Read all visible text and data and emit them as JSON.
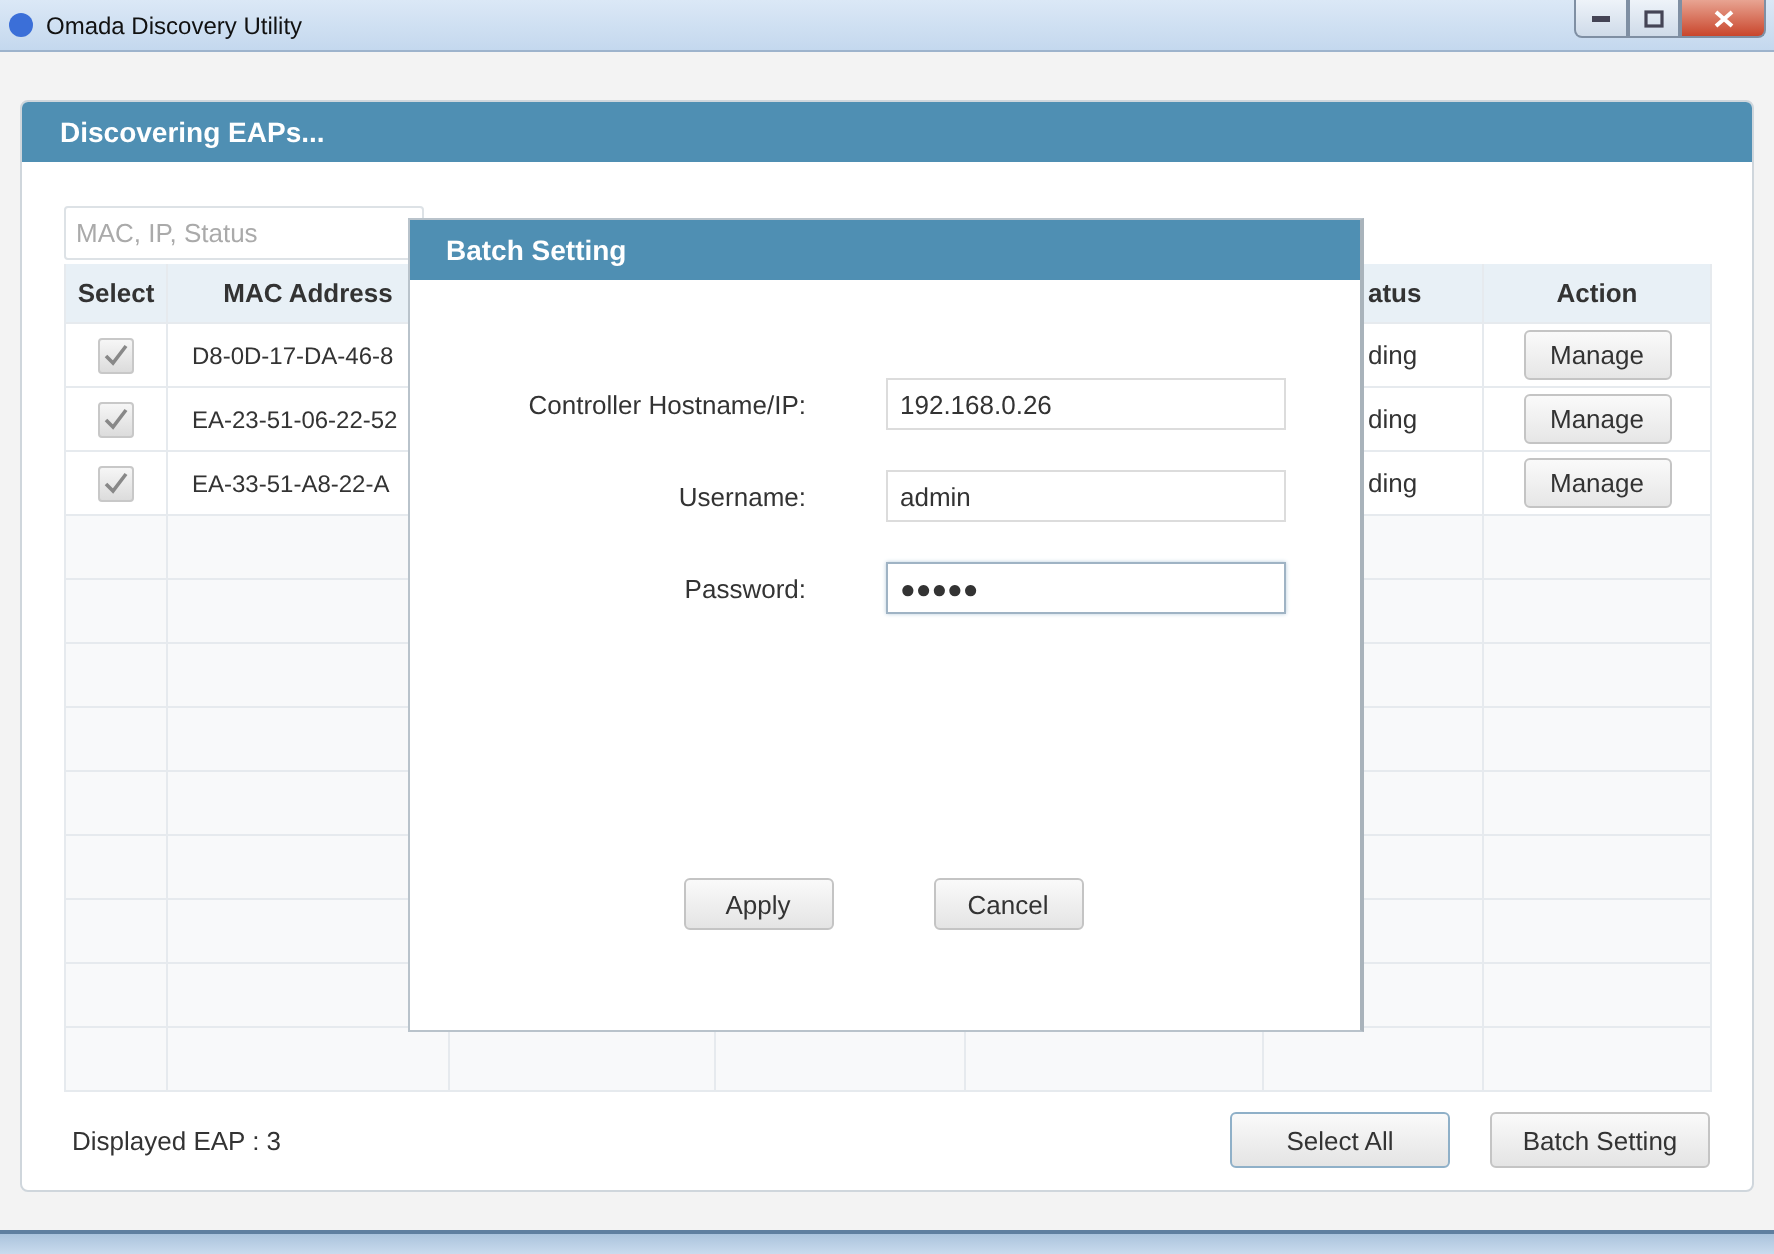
{
  "window": {
    "title": "Omada Discovery Utility"
  },
  "panel": {
    "title": "Discovering EAPs..."
  },
  "search": {
    "placeholder": "MAC, IP, Status"
  },
  "table": {
    "columns": {
      "select": "Select",
      "mac_address": "MAC Address",
      "column_6": "atus",
      "action": "Action"
    },
    "rows": [
      {
        "checked": true,
        "mac_address": "D8-0D-17-DA-46-8",
        "column_6": "ding",
        "action": "Manage"
      },
      {
        "checked": true,
        "mac_address": "EA-23-51-06-22-52",
        "column_6": "ding",
        "action": "Manage"
      },
      {
        "checked": true,
        "mac_address": "EA-33-51-A8-22-A",
        "column_6": "ding",
        "action": "Manage"
      }
    ]
  },
  "footer": {
    "count": "Displayed EAP : 3",
    "buttons": [
      {
        "label": "Select All",
        "focused": true
      },
      {
        "label": "Batch Setting",
        "focused": false
      }
    ]
  },
  "dialog": {
    "title": "Batch Setting",
    "fields": [
      {
        "label": "Controller Hostname/IP:",
        "value": "192.168.0.26",
        "focused": false
      },
      {
        "label": "Username:",
        "value": "admin",
        "focused": false
      },
      {
        "label": "Password:",
        "value": "●●●●●",
        "focused": true
      }
    ],
    "buttons": [
      {
        "label": "Apply"
      },
      {
        "label": "Cancel"
      }
    ]
  }
}
